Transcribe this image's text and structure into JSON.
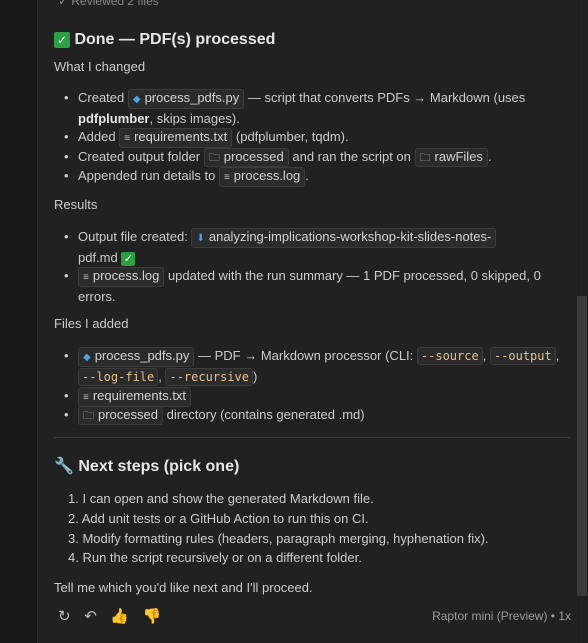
{
  "top": {
    "text": "Reviewed 2 files"
  },
  "title": "Done — PDF(s) processed",
  "changed": {
    "heading": "What I changed",
    "l1": {
      "pre": "Created",
      "file": "process_pdfs.py",
      "post": "— script that converts PDFs → Markdown (uses",
      "bold": "pdfplumber",
      "post2": ", skips images)."
    },
    "l2": {
      "pre": "Added",
      "file": "requirements.txt",
      "post": "(pdfplumber, tqdm)."
    },
    "l3": {
      "pre": "Created output folder",
      "folder": "processed",
      "mid": "and ran the script on",
      "folder2": "rawFiles",
      "post": "."
    },
    "l4": {
      "pre": "Appended run details to",
      "file": "process.log",
      "post": "."
    }
  },
  "results": {
    "heading": "Results",
    "r1": {
      "pre": "Output file created:",
      "file": "analyzing-implications-workshop-kit-slides-notes-",
      "file2": "pdf.md"
    },
    "r2": {
      "file": "process.log",
      "post": "updated with the run summary — 1 PDF processed, 0 skipped, 0",
      "post2": "errors."
    }
  },
  "files": {
    "heading": "Files I added",
    "f1": {
      "file": "process_pdfs.py",
      "post": "— PDF → Markdown processor (CLI:",
      "c1": "--source",
      "c2": "--output",
      "c3": "--log-file",
      "c4": "--recursive"
    },
    "f2": {
      "file": "requirements.txt"
    },
    "f3": {
      "folder": "processed",
      "post": "directory (contains generated .md)"
    }
  },
  "next": {
    "heading": "Next steps (pick one)",
    "steps": [
      "I can open and show the generated Markdown file.",
      "Add unit tests or a GitHub Action to run this on CI.",
      "Modify formatting rules (headers, paragraph merging, hyphenation fix).",
      "Run the script recursively or on a different folder."
    ]
  },
  "closing": "Tell me which you'd like next and I'll proceed.",
  "footer": {
    "model": "Raptor mini (Preview) • 1x"
  }
}
